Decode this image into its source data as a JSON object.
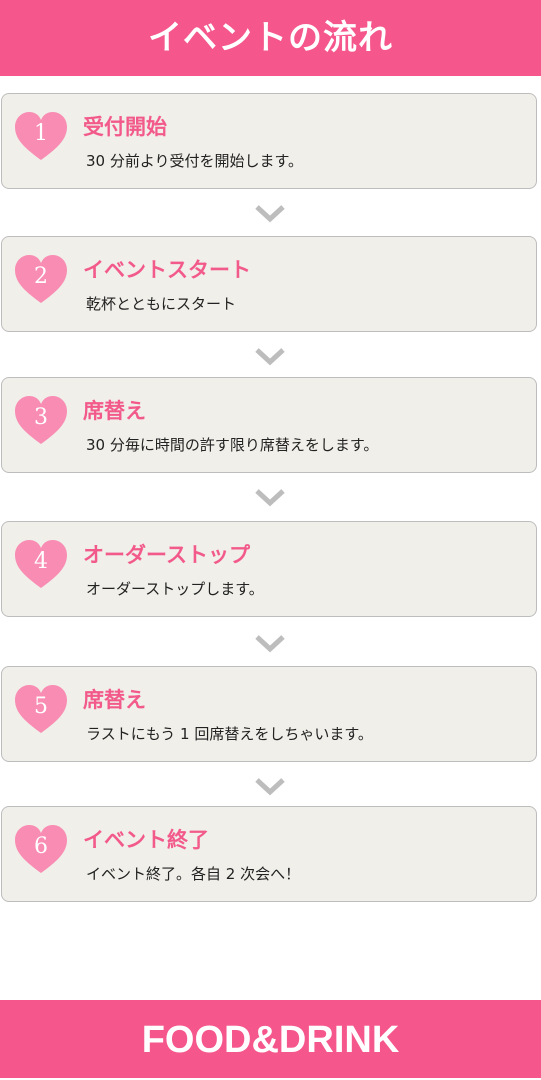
{
  "header": {
    "title": "イベントの流れ"
  },
  "steps": [
    {
      "number": "1",
      "title": "受付開始",
      "description": "30 分前より受付を開始します。"
    },
    {
      "number": "2",
      "title": "イベントスタート",
      "description": "乾杯とともにスタート"
    },
    {
      "number": "3",
      "title": "席替え",
      "description": "30 分毎に時間の許す限り席替えをします。"
    },
    {
      "number": "4",
      "title": "オーダーストップ",
      "description": "オーダーストップします。"
    },
    {
      "number": "5",
      "title": "席替え",
      "description": "ラストにもう 1 回席替えをしちゃいます。"
    },
    {
      "number": "6",
      "title": "イベント終了",
      "description": "イベント終了。各自 2 次会へ！"
    }
  ],
  "icons": {
    "step_marker": "heart-icon",
    "connector": "chevron-down-icon"
  },
  "footer": {
    "title": "FOOD&DRINK"
  },
  "colors": {
    "brand_pink": "#f5568b",
    "heart_pink": "#f98cb3",
    "card_background": "#f0efe9",
    "card_border": "#bdbdbd",
    "chevron_gray": "#bdbdbd"
  }
}
